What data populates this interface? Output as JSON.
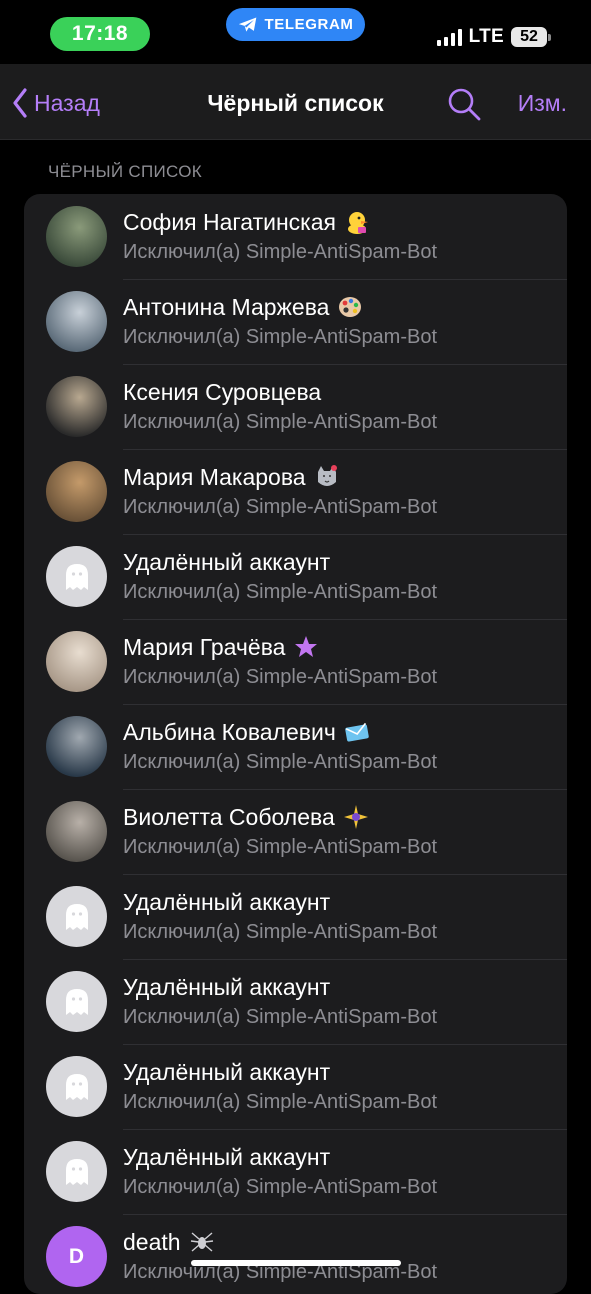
{
  "status_bar": {
    "time": "17:18",
    "app_pill": "TELEGRAM",
    "network": "LTE",
    "battery": "52"
  },
  "nav": {
    "back_label": "Назад",
    "title": "Чёрный список",
    "edit_label": "Изм."
  },
  "section_header": "ЧЁРНЫЙ СПИСОК",
  "rows": [
    {
      "name": "София Нагатинская",
      "sub": "Исключил(а) Simple-AntiSpam-Bot",
      "avatar": "photo",
      "emoji": "duck-icon"
    },
    {
      "name": "Антонина Маржева",
      "sub": "Исключил(а) Simple-AntiSpam-Bot",
      "avatar": "photo",
      "emoji": "palette-icon"
    },
    {
      "name": "Ксения Суровцева",
      "sub": "Исключил(а) Simple-AntiSpam-Bot",
      "avatar": "photo",
      "emoji": ""
    },
    {
      "name": "Мария Макарова",
      "sub": "Исключил(а) Simple-AntiSpam-Bot",
      "avatar": "photo",
      "emoji": "cat-icon"
    },
    {
      "name": "Удалённый аккаунт",
      "sub": "Исключил(а) Simple-AntiSpam-Bot",
      "avatar": "ghost",
      "emoji": ""
    },
    {
      "name": "Мария Грачёва",
      "sub": "Исключил(а) Simple-AntiSpam-Bot",
      "avatar": "photo",
      "emoji": "star-icon"
    },
    {
      "name": "Альбина Ковалевич",
      "sub": "Исключил(а) Simple-AntiSpam-Bot",
      "avatar": "photo",
      "emoji": "envelope-icon"
    },
    {
      "name": "Виолетта Соболева",
      "sub": "Исключил(а) Simple-AntiSpam-Bot",
      "avatar": "photo",
      "emoji": "sparkle-icon"
    },
    {
      "name": "Удалённый аккаунт",
      "sub": "Исключил(а) Simple-AntiSpam-Bot",
      "avatar": "ghost",
      "emoji": ""
    },
    {
      "name": "Удалённый аккаунт",
      "sub": "Исключил(а) Simple-AntiSpam-Bot",
      "avatar": "ghost",
      "emoji": ""
    },
    {
      "name": "Удалённый аккаунт",
      "sub": "Исключил(а) Simple-AntiSpam-Bot",
      "avatar": "ghost",
      "emoji": ""
    },
    {
      "name": "Удалённый аккаунт",
      "sub": "Исключил(а) Simple-AntiSpam-Bot",
      "avatar": "ghost",
      "emoji": ""
    },
    {
      "name": "death",
      "sub": "Исключил(а) Simple-AntiSpam-Bot",
      "avatar": "letter",
      "letter": "D",
      "emoji": "spider-icon"
    }
  ],
  "colors": {
    "accent": "#b47ef8",
    "time_pill": "#3ad159",
    "telegram_pill": "#2f86f6",
    "background": "#000000",
    "list_background": "#1c1c1e"
  }
}
